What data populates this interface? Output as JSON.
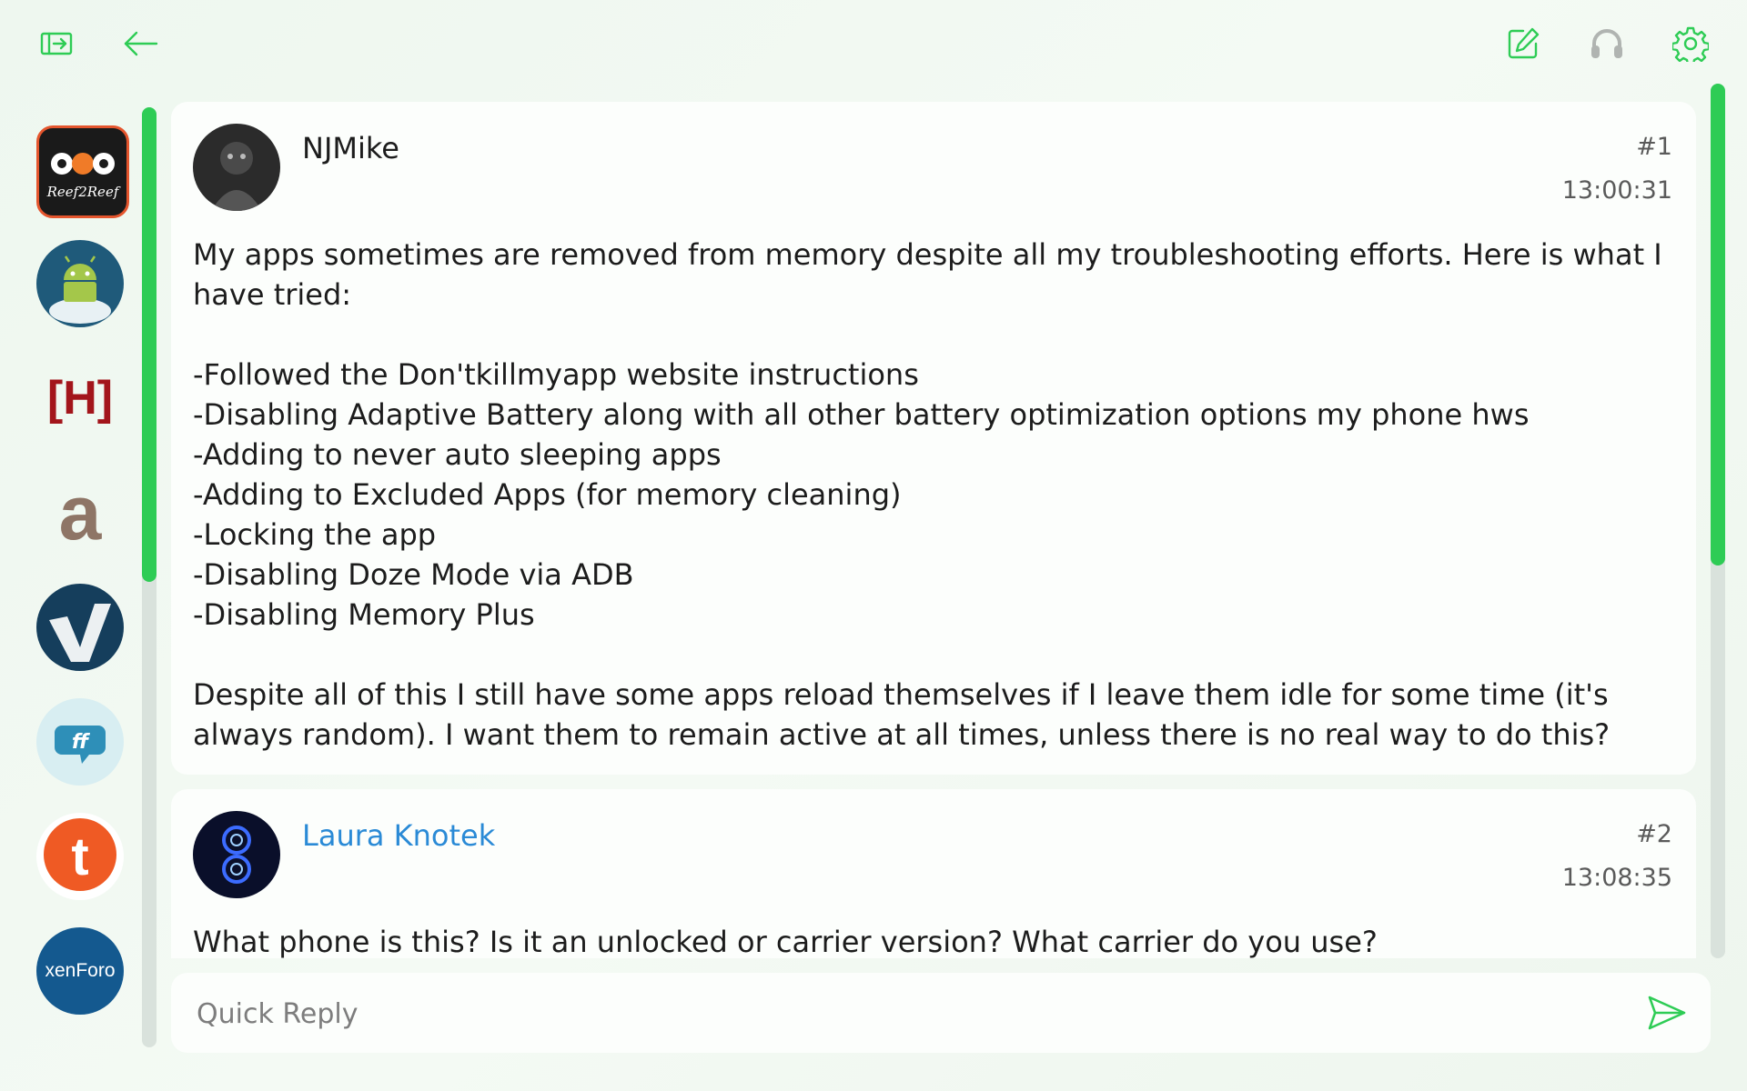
{
  "topbar": {
    "left": [
      "sidebar-toggle-icon",
      "back-arrow-icon"
    ],
    "right": [
      "compose-icon",
      "headphones-icon",
      "gear-icon"
    ],
    "accent": "#2ecc55"
  },
  "forums": [
    {
      "name": "Reef2Reef",
      "logo_text": "Reef2Reef",
      "bg": "#1a1a1a"
    },
    {
      "name": "android-forum",
      "logo_text": "",
      "bg": "#1f5a7a"
    },
    {
      "name": "hardforum",
      "logo_text": "[H]",
      "bg": "transparent"
    },
    {
      "name": "a-forum",
      "logo_text": "a",
      "bg": "transparent"
    },
    {
      "name": "v-forum",
      "logo_text": "V",
      "bg": "#153e5c"
    },
    {
      "name": "ff-forum",
      "logo_text": "ff",
      "bg": "#d8eef2"
    },
    {
      "name": "tapatalk",
      "logo_text": "t",
      "bg": "#ef5a24"
    },
    {
      "name": "xenforo",
      "logo_text": "xenForo",
      "bg": "#14598f"
    }
  ],
  "posts": [
    {
      "author": "NJMike",
      "author_color": "#1c1c1c",
      "number": "#1",
      "time": "13:00:31",
      "paragraphs": [
        "My apps sometimes are removed from memory despite all my troubleshooting efforts. Here is what I have tried:",
        "",
        "-Followed the Don'tkillmyapp website instructions",
        "-Disabling Adaptive Battery along with all other battery optimization options my phone hws",
        "-Adding to never auto sleeping apps",
        "-Adding to Excluded Apps (for memory cleaning)",
        "-Locking the app",
        "-Disabling Doze Mode via ADB",
        "-Disabling Memory Plus",
        "",
        "Despite all of this I still have some apps reload themselves if I leave them idle for some time (it's always random). I want them to remain active at all times, unless there is no real way to do this?"
      ]
    },
    {
      "author": "Laura Knotek",
      "author_color": "#2a8ad6",
      "number": "#2",
      "time": "13:08:35",
      "paragraphs": [
        "What phone is this? Is it an unlocked or carrier version? What carrier do you use?"
      ]
    }
  ],
  "reply": {
    "placeholder": "Quick Reply",
    "send_icon": "send-icon"
  }
}
